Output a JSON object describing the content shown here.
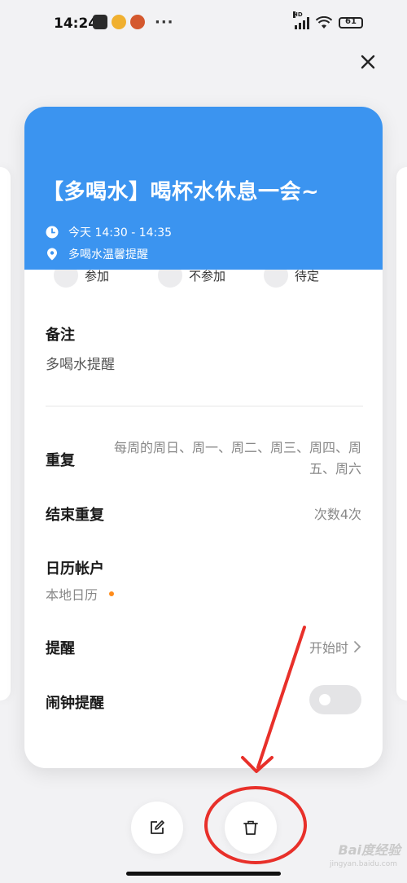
{
  "status_bar": {
    "time": "14:24",
    "more": "···",
    "network": "HD",
    "battery": "61"
  },
  "event": {
    "title": "【多喝水】喝杯水休息一会~",
    "time_text": "今天 14:30 - 14:35",
    "location_text": "多喝水温馨提醒",
    "header_color": "#3b94f0"
  },
  "rsvp": {
    "accept": "参加",
    "decline": "不参加",
    "tentative": "待定"
  },
  "notes": {
    "label": "备注",
    "value": "多喝水提醒"
  },
  "repeat": {
    "label": "重复",
    "value": "每周的周日、周一、周二、周三、周四、周五、周六"
  },
  "end_repeat": {
    "label": "结束重复",
    "value": "次数4次"
  },
  "calendar_account": {
    "label": "日历帐户",
    "value": "本地日历",
    "dot_color": "#ff8c1a"
  },
  "reminder": {
    "label": "提醒",
    "value": "开始时"
  },
  "alarm": {
    "label": "闹钟提醒",
    "enabled": false
  },
  "icons": {
    "close": "close-icon",
    "edit": "edit-icon",
    "delete": "trash-icon",
    "clock": "clock-icon",
    "location": "location-pin-icon"
  },
  "annotation_color": "#e8302a",
  "watermark": {
    "brand": "Bai度经验",
    "url": "jingyan.baidu.com"
  }
}
